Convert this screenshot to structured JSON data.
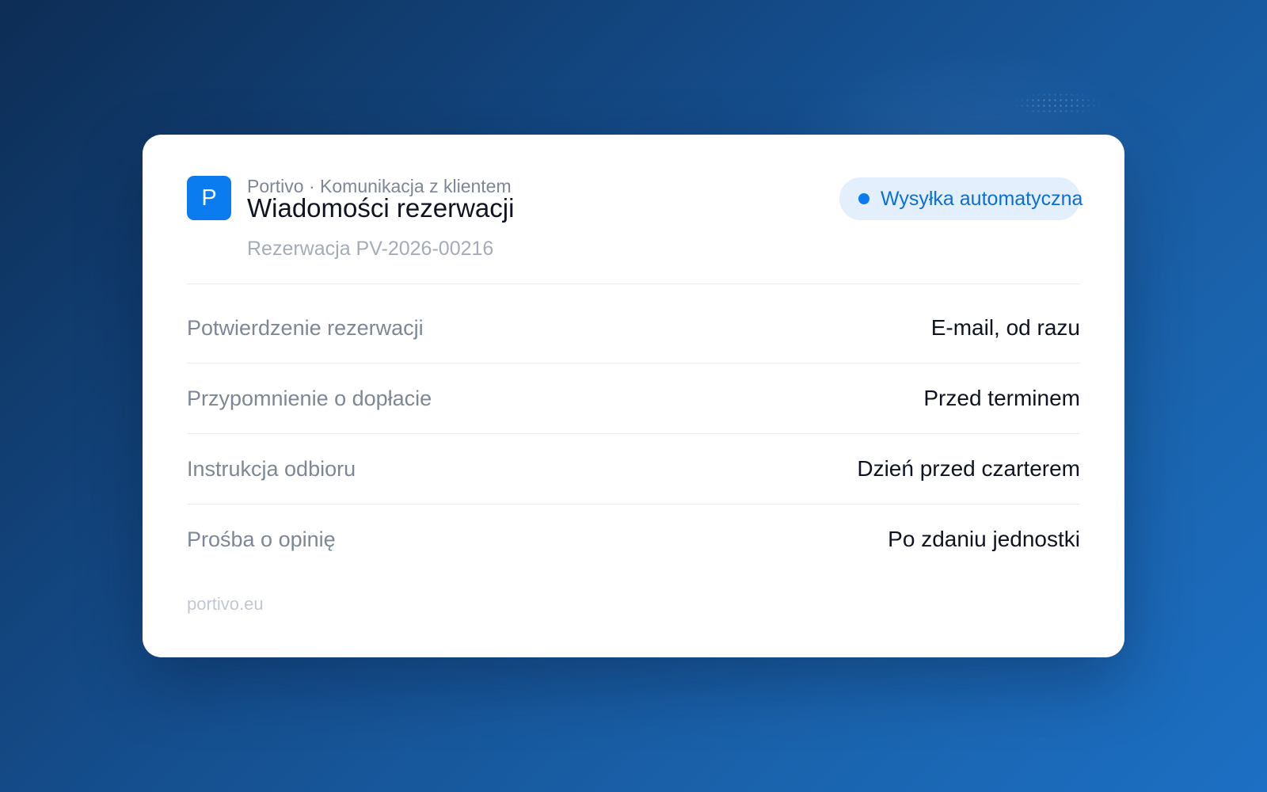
{
  "colors": {
    "accent": "#0b7bf0",
    "pill_background": "#e3effc",
    "background_dark": "#0d2d55",
    "background_light": "#1c6fc4"
  },
  "app": {
    "logo_letter": "P",
    "subtitle": "Portivo · Komunikacja z klientem",
    "title": "Wiadomości rezerwacji",
    "booking_reference": "Rezerwacja PV-2026-00216"
  },
  "status": {
    "label": "Wysyłka automatyczna",
    "icon": "status-dot-icon"
  },
  "messages": [
    {
      "label": "Potwierdzenie rezerwacji",
      "value": "E-mail, od razu"
    },
    {
      "label": "Przypomnienie o dopłacie",
      "value": "Przed terminem"
    },
    {
      "label": "Instrukcja odbioru",
      "value": "Dzień przed czarterem"
    },
    {
      "label": "Prośba o opinię",
      "value": "Po zdaniu jednostki"
    }
  ],
  "footer": {
    "domain": "portivo.eu"
  }
}
